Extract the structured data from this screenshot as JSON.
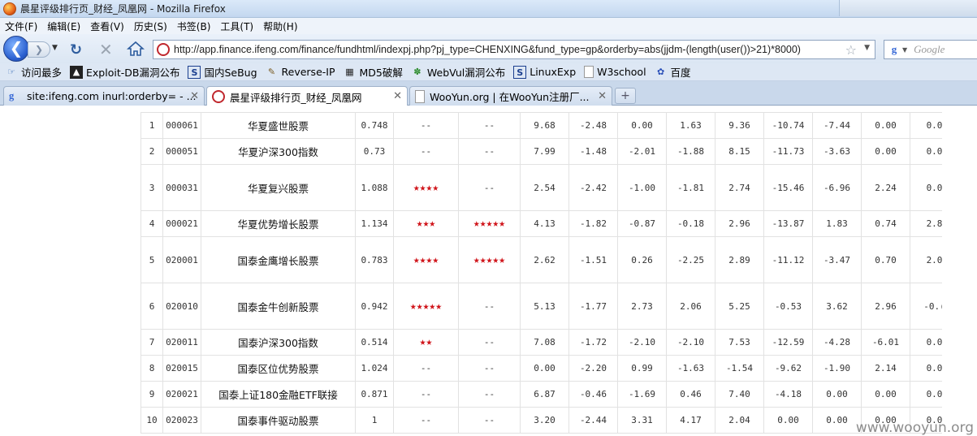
{
  "window": {
    "title": "晨星评级排行页_财经_凤凰网 - Mozilla Firefox"
  },
  "menu": [
    "文件(F)",
    "编辑(E)",
    "查看(V)",
    "历史(S)",
    "书签(B)",
    "工具(T)",
    "帮助(H)"
  ],
  "nav": {
    "url": "http://app.finance.ifeng.com/finance/fundhtml/indexpj.php?pj_type=CHENXING&fund_type=gp&orderby=abs(jjdm-(length(user())>21)*8000)",
    "search_placeholder": "Google"
  },
  "bookmarks": [
    {
      "label": "访问最多",
      "icon": "bookmark-folder-icon"
    },
    {
      "label": "Exploit-DB漏洞公布",
      "icon": "exploit-db-icon"
    },
    {
      "label": "国内SeBug",
      "icon": "sebug-icon"
    },
    {
      "label": "Reverse-IP",
      "icon": "reverse-ip-icon"
    },
    {
      "label": "MD5破解",
      "icon": "md5-icon"
    },
    {
      "label": "WebVul漏洞公布",
      "icon": "webvul-icon"
    },
    {
      "label": "LinuxExp",
      "icon": "linuxexp-icon"
    },
    {
      "label": "W3school",
      "icon": "page-icon"
    },
    {
      "label": "百度",
      "icon": "baidu-icon"
    }
  ],
  "tabs": [
    {
      "label": "site:ifeng.com inurl:orderby= - ...",
      "active": false
    },
    {
      "label": "晨星评级排行页_财经_凤凰网",
      "active": true
    },
    {
      "label": "WooYun.org | 在WooYun注册厂...",
      "active": false
    }
  ],
  "funds": [
    {
      "rank": "1",
      "code": "000061",
      "name": "华夏盛世股票",
      "nav": "0.748",
      "rating3": "--",
      "rating5": "--",
      "v": [
        "9.68",
        "-2.48",
        "0.00",
        "1.63",
        "9.36",
        "-10.74",
        "-7.44",
        "0.00",
        "0.0"
      ]
    },
    {
      "rank": "2",
      "code": "000051",
      "name": "华夏沪深300指数",
      "nav": "0.73",
      "rating3": "--",
      "rating5": "--",
      "v": [
        "7.99",
        "-1.48",
        "-2.01",
        "-1.88",
        "8.15",
        "-11.73",
        "-3.63",
        "0.00",
        "0.0"
      ]
    },
    {
      "rank": "3",
      "code": "000031",
      "name": "华夏复兴股票",
      "nav": "1.088",
      "rating3": "★★★★",
      "rating5": "--",
      "v": [
        "2.54",
        "-2.42",
        "-1.00",
        "-1.81",
        "2.74",
        "-15.46",
        "-6.96",
        "2.24",
        "0.0"
      ]
    },
    {
      "rank": "4",
      "code": "000021",
      "name": "华夏优势增长股票",
      "nav": "1.134",
      "rating3": "★★★",
      "rating5": "★★★★★",
      "v": [
        "4.13",
        "-1.82",
        "-0.87",
        "-0.18",
        "2.96",
        "-13.87",
        "1.83",
        "0.74",
        "2.8"
      ]
    },
    {
      "rank": "5",
      "code": "020001",
      "name": "国泰金鹰增长股票",
      "nav": "0.783",
      "rating3": "★★★★",
      "rating5": "★★★★★",
      "v": [
        "2.62",
        "-1.51",
        "0.26",
        "-2.25",
        "2.89",
        "-11.12",
        "-3.47",
        "0.70",
        "2.0"
      ]
    },
    {
      "rank": "6",
      "code": "020010",
      "name": "国泰金牛创新股票",
      "nav": "0.942",
      "rating3": "★★★★★",
      "rating5": "--",
      "v": [
        "5.13",
        "-1.77",
        "2.73",
        "2.06",
        "5.25",
        "-0.53",
        "3.62",
        "2.96",
        "-0.("
      ]
    },
    {
      "rank": "7",
      "code": "020011",
      "name": "国泰沪深300指数",
      "nav": "0.514",
      "rating3": "★★",
      "rating5": "--",
      "v": [
        "7.08",
        "-1.72",
        "-2.10",
        "-2.10",
        "7.53",
        "-12.59",
        "-4.28",
        "-6.01",
        "0.0"
      ]
    },
    {
      "rank": "8",
      "code": "020015",
      "name": "国泰区位优势股票",
      "nav": "1.024",
      "rating3": "--",
      "rating5": "--",
      "v": [
        "0.00",
        "-2.20",
        "0.99",
        "-1.63",
        "-1.54",
        "-9.62",
        "-1.90",
        "2.14",
        "0.0"
      ]
    },
    {
      "rank": "9",
      "code": "020021",
      "name": "国泰上证180金融ETF联接",
      "nav": "0.871",
      "rating3": "--",
      "rating5": "--",
      "v": [
        "6.87",
        "-0.46",
        "-1.69",
        "0.46",
        "7.40",
        "-4.18",
        "0.00",
        "0.00",
        "0.0"
      ]
    },
    {
      "rank": "10",
      "code": "020023",
      "name": "国泰事件驱动股票",
      "nav": "1",
      "rating3": "--",
      "rating5": "--",
      "v": [
        "3.20",
        "-2.44",
        "3.31",
        "4.17",
        "2.04",
        "0.00",
        "0.00",
        "0.00",
        "0.0"
      ]
    }
  ],
  "watermark": "www.wooyun.org"
}
